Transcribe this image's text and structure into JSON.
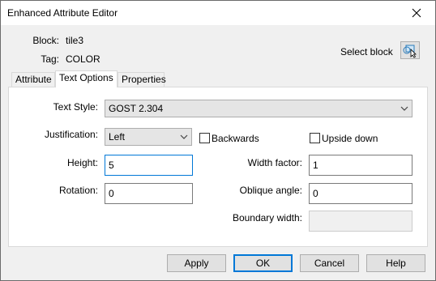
{
  "window": {
    "title": "Enhanced Attribute Editor"
  },
  "header": {
    "block_label": "Block:",
    "block_value": "tile3",
    "tag_label": "Tag:",
    "tag_value": "COLOR",
    "select_block_label": "Select block",
    "select_block_icon": "select-objects-icon"
  },
  "tabs": [
    {
      "label": "Attribute",
      "active": false
    },
    {
      "label": "Text Options",
      "active": true
    },
    {
      "label": "Properties",
      "active": false
    }
  ],
  "text_options": {
    "text_style_label": "Text Style:",
    "text_style_value": "GOST 2.304",
    "justification_label": "Justification:",
    "justification_value": "Left",
    "backwards_label": "Backwards",
    "backwards_checked": false,
    "upside_down_label": "Upside down",
    "upside_down_checked": false,
    "height_label": "Height:",
    "height_value": "5",
    "width_factor_label": "Width factor:",
    "width_factor_value": "1",
    "rotation_label": "Rotation:",
    "rotation_value": "0",
    "oblique_angle_label": "Oblique angle:",
    "oblique_angle_value": "0",
    "boundary_width_label": "Boundary width:",
    "boundary_width_value": ""
  },
  "buttons": {
    "apply": "Apply",
    "ok": "OK",
    "cancel": "Cancel",
    "help": "Help"
  }
}
